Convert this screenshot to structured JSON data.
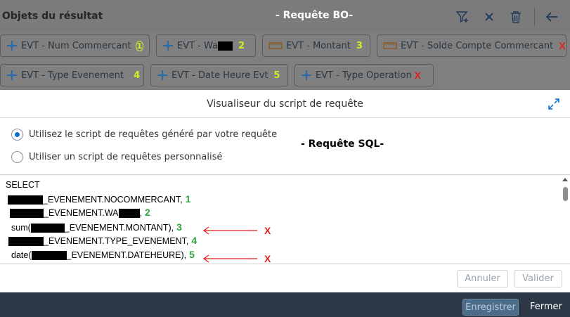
{
  "header": {
    "left_title": "Objets du résultat",
    "center_title": "- Requête BO-",
    "icons": [
      "add-filter-icon",
      "close-icon",
      "delete-icon",
      "back-arrow-icon"
    ]
  },
  "chips": [
    {
      "label": "EVT - Num Commercant",
      "mark": "1",
      "icon": "dimension-icon"
    },
    {
      "label": "EVT - Wa",
      "mark": "2",
      "icon": "dimension-icon"
    },
    {
      "label": "EVT - Montant",
      "mark": "3",
      "icon": "measure-icon"
    },
    {
      "label": "EVT - Solde Compte Commercant",
      "mark": "X",
      "icon": "measure-icon"
    },
    {
      "label": "EVT - Type Evenement",
      "mark": "4",
      "icon": "dimension-icon"
    },
    {
      "label": "EVT - Date Heure Evt",
      "mark": "5",
      "icon": "dimension-icon"
    },
    {
      "label": "EVT - Type Operation",
      "mark": "X",
      "icon": "dimension-icon"
    }
  ],
  "dialog": {
    "title": "Visualiseur du script de requête",
    "radio_generated": "Utilisez le script de requêtes généré par votre requête",
    "radio_custom": "Utiliser un script de requêtes personnalisé",
    "selected": "generated",
    "sql_annotation": "- Requête SQL-",
    "script": [
      {
        "text": "SELECT",
        "mark": ""
      },
      {
        "text": "_EVENEMENT.NOCOMMERCANT,",
        "mark": "1"
      },
      {
        "text": "_EVENEMENT.WA",
        "mark": "2"
      },
      {
        "text": "sum(",
        "text2": "_EVENEMENT.MONTANT),",
        "mark": "3"
      },
      {
        "text": "_EVENEMENT.TYPE_EVENEMENT,",
        "mark": "4"
      },
      {
        "text": "date(",
        "text2": "_EVENEMENT.DATEHEURE),",
        "mark": "5"
      }
    ],
    "annot_x1": "X",
    "annot_x2": "X",
    "cancel_label": "Annuler",
    "validate_label": "Valider"
  },
  "footer": {
    "save_label": "Enregistrer",
    "close_label": "Fermer"
  },
  "colors": {
    "accent": "#0a6ed1",
    "annotation_green": "#2aa43a",
    "annotation_yellow": "#d4ec28",
    "annotation_red": "#e41f1f",
    "footer_bg": "#2c3845"
  }
}
